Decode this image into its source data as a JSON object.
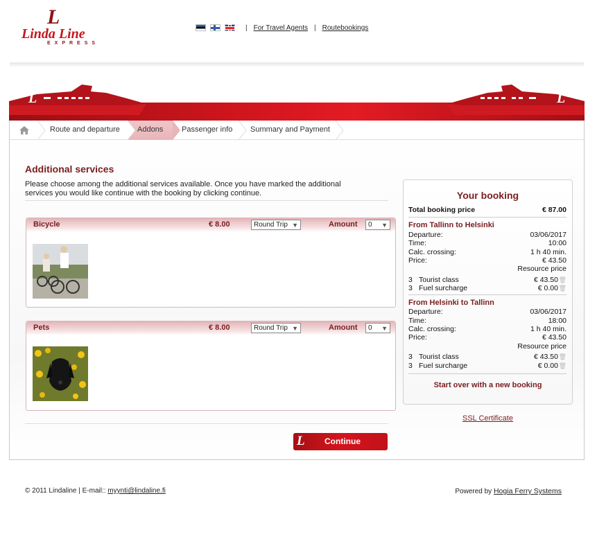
{
  "brand": {
    "mark": "L",
    "name": "Linda Line",
    "sub": "EXPRESS"
  },
  "topbar": {
    "flags": [
      "estonian-flag",
      "finnish-flag",
      "english-flag"
    ],
    "separator": "|",
    "links": [
      "For Travel Agents",
      "Routebookings"
    ]
  },
  "breadcrumbs": {
    "home_icon": "home-icon",
    "steps": [
      "Route and departure",
      "Addons",
      "Passenger info",
      "Summary and Payment"
    ],
    "active": "Addons"
  },
  "main": {
    "title": "Additional services",
    "intro": "Please choose among the additional services available. Once you have marked the additional services you would like continue with the booking by clicking continue.",
    "services": [
      {
        "name": "Bicycle",
        "price": "€ 8.00",
        "trip": "Round Trip",
        "amount_label": "Amount",
        "amount": "0",
        "image": "bicycle-photo"
      },
      {
        "name": "Pets",
        "price": "€ 8.00",
        "trip": "Round Trip",
        "amount_label": "Amount",
        "amount": "0",
        "image": "dog-photo"
      }
    ],
    "continue_label": "Continue"
  },
  "booking": {
    "title": "Your booking",
    "total_label": "Total booking price",
    "total": "€ 87.00",
    "routes": [
      {
        "heading": "From Tallinn to Helsinki",
        "departure_label": "Departure:",
        "departure": "03/06/2017",
        "time_label": "Time:",
        "time": "10:00",
        "crossing_label": "Calc. crossing:",
        "crossing": "1 h 40 min.",
        "price_label": "Price:",
        "price": "€ 43.50",
        "resource_label": "Resource price",
        "items": [
          {
            "qty": "3",
            "name": "Tourist class",
            "price": "€ 43.50"
          },
          {
            "qty": "3",
            "name": "Fuel surcharge",
            "price": "€ 0.00"
          }
        ]
      },
      {
        "heading": "From Helsinki to Tallinn",
        "departure_label": "Departure:",
        "departure": "03/06/2017",
        "time_label": "Time:",
        "time": "18:00",
        "crossing_label": "Calc. crossing:",
        "crossing": "1 h 40 min.",
        "price_label": "Price:",
        "price": "€ 43.50",
        "resource_label": "Resource price",
        "items": [
          {
            "qty": "3",
            "name": "Tourist class",
            "price": "€ 43.50"
          },
          {
            "qty": "3",
            "name": "Fuel surcharge",
            "price": "€ 0.00"
          }
        ]
      }
    ],
    "start_over": "Start over with a new booking"
  },
  "ssl_label": "SSL Certificate",
  "footer": {
    "copyright": "© 2011 Lindaline | E-mail::",
    "email": "myynti@lindaline.fi",
    "powered_by": "Powered by",
    "powered_link": "Hogia Ferry Systems"
  },
  "colors": {
    "brand_red": "#c7161d",
    "dark_red": "#7a1d1f",
    "active_step": "#e8b5b9"
  }
}
